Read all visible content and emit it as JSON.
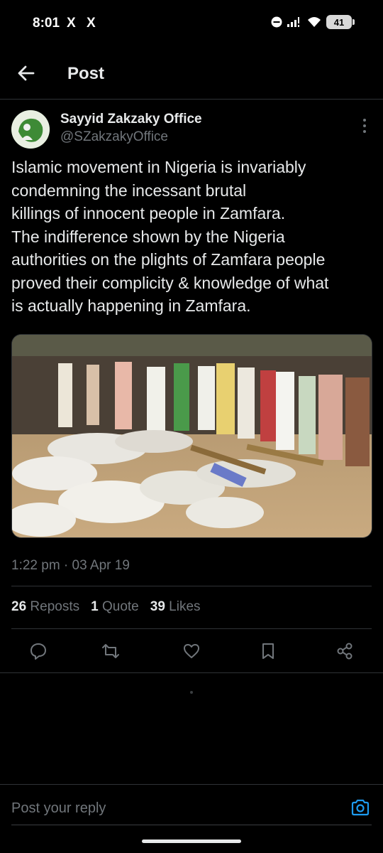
{
  "status": {
    "time": "8:01",
    "x_icon_1": "X",
    "x_icon_2": "X",
    "battery": "41"
  },
  "header": {
    "title": "Post"
  },
  "post": {
    "author_name": "Sayyid Zakzaky Office",
    "author_handle": "@SZakzakyOffice",
    "text": "Islamic movement in Nigeria is invariably\ncondemning the incessant brutal\nkillings of innocent people in Zamfara.\nThe indifference shown by the Nigeria\nauthorities on the plights of Zamfara people\nproved their complicity & knowledge of what\nis actually happening in Zamfara.",
    "timestamp": "1:22 pm · 03 Apr 19",
    "reposts_count": "26",
    "reposts_label": "Reposts",
    "quotes_count": "1",
    "quotes_label": "Quote",
    "likes_count": "39",
    "likes_label": "Likes"
  },
  "actions": [
    "reply-icon",
    "repost-icon",
    "like-icon",
    "bookmark-icon",
    "share-icon"
  ],
  "reply": {
    "placeholder": "Post your reply"
  },
  "colors": {
    "background": "#000000",
    "text": "#e7e9ea",
    "secondary": "#71767b",
    "accent": "#1d9bf0"
  }
}
